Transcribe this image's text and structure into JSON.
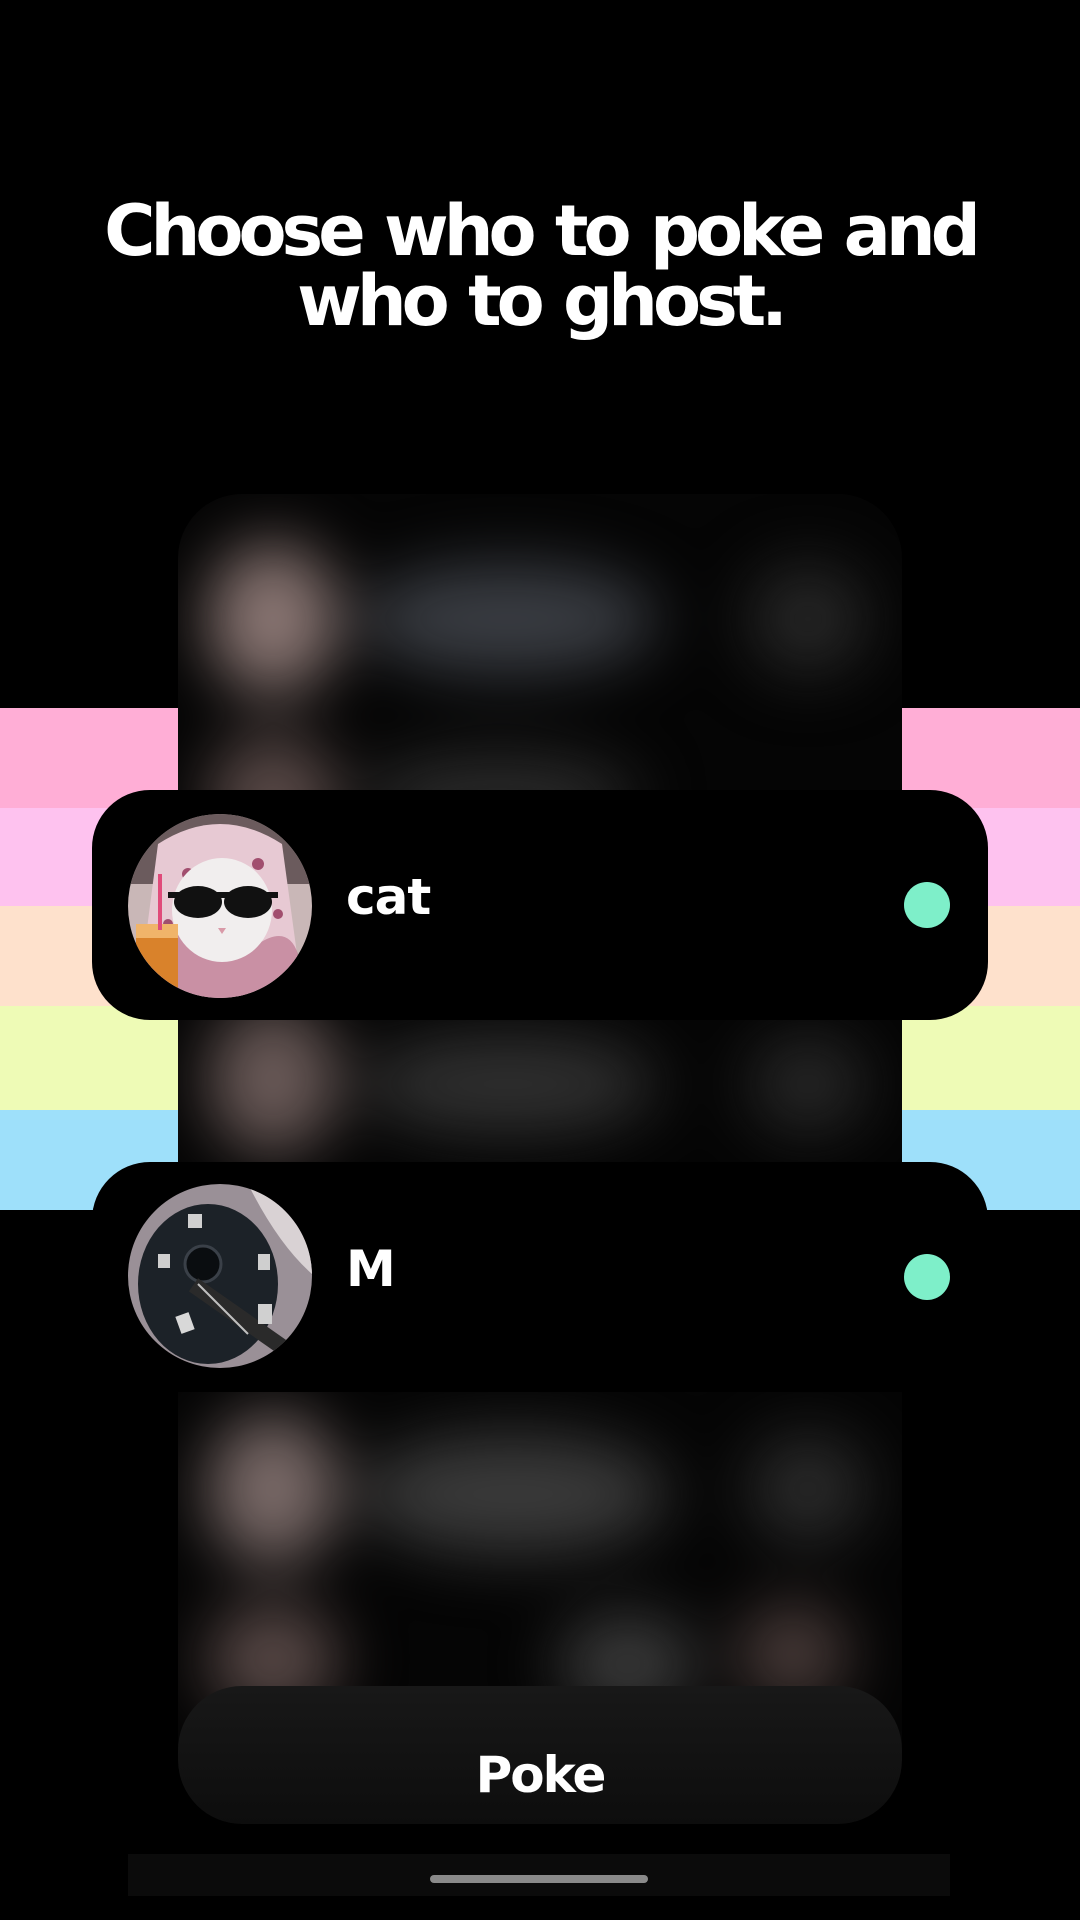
{
  "headline": {
    "line1": "Choose who to poke and",
    "line2": "who to ghost."
  },
  "rainbow_colors": [
    "#ffaed6",
    "#fec2ef",
    "#fee1cc",
    "#eefbb6",
    "#9ee0fa"
  ],
  "contacts": [
    {
      "name": "cat",
      "avatar_icon": "cat-with-sunglasses-photo",
      "status": "online",
      "status_color": "#7eefc9"
    },
    {
      "name": "M",
      "avatar_icon": "guitar-photo",
      "status": "online",
      "status_color": "#7eefc9"
    }
  ],
  "phone_mockup": {
    "button_label": "Poke"
  }
}
